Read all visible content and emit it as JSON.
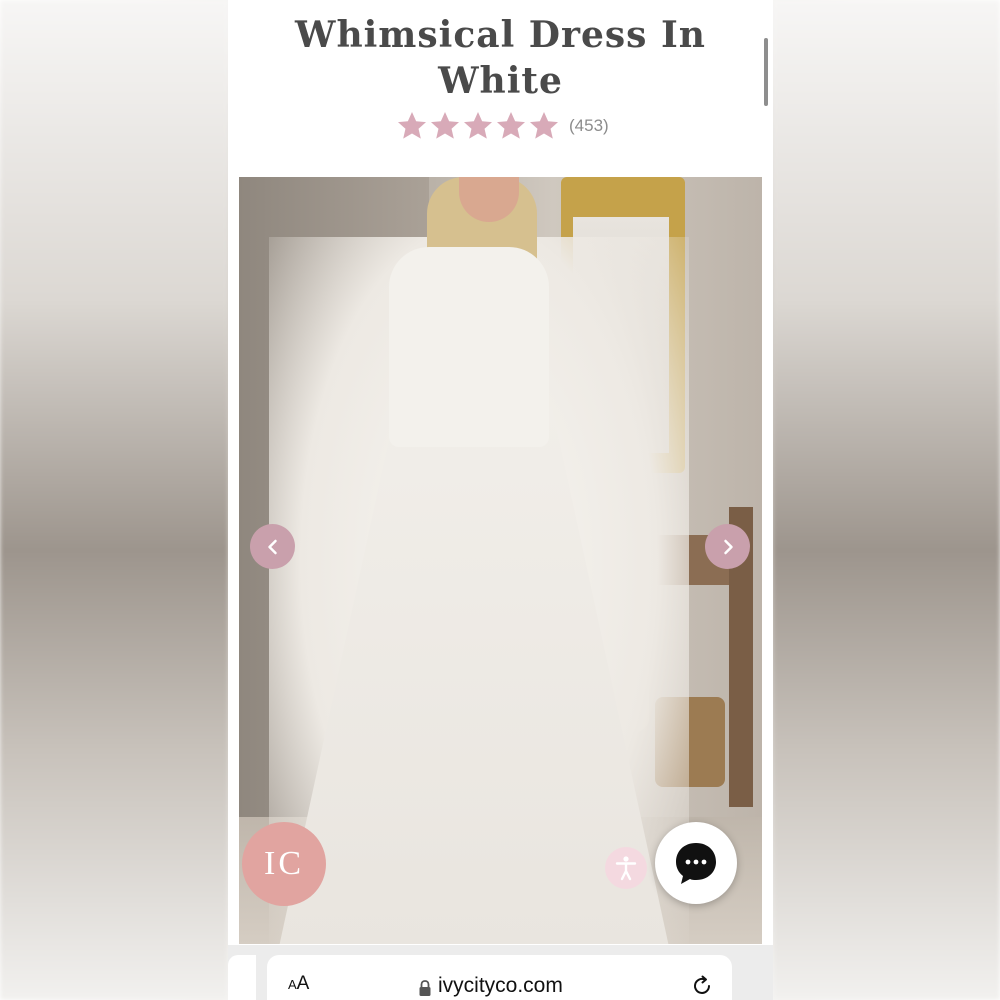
{
  "product": {
    "title_line1": "Whimsical Dress In",
    "title_line2": "White",
    "rating": 5,
    "rating_max": 5,
    "review_count": "(453)"
  },
  "gallery": {
    "prev_icon": "chevron-left-icon",
    "next_icon": "chevron-right-icon"
  },
  "badge": {
    "logo_text": "IC"
  },
  "widgets": {
    "accessibility_icon": "accessibility-icon",
    "chat_icon": "chat-bubble-icon"
  },
  "browser": {
    "aa_label_big": "A",
    "aa_label_small": "A",
    "url": "ivycityco.com",
    "lock_icon": "lock-icon",
    "reload_icon": "reload-icon"
  },
  "colors": {
    "star": "#d8aab8",
    "arrow_bg": "#c9a0ac",
    "logo_bg": "#e1a4a0",
    "title": "#4a4a4a"
  }
}
